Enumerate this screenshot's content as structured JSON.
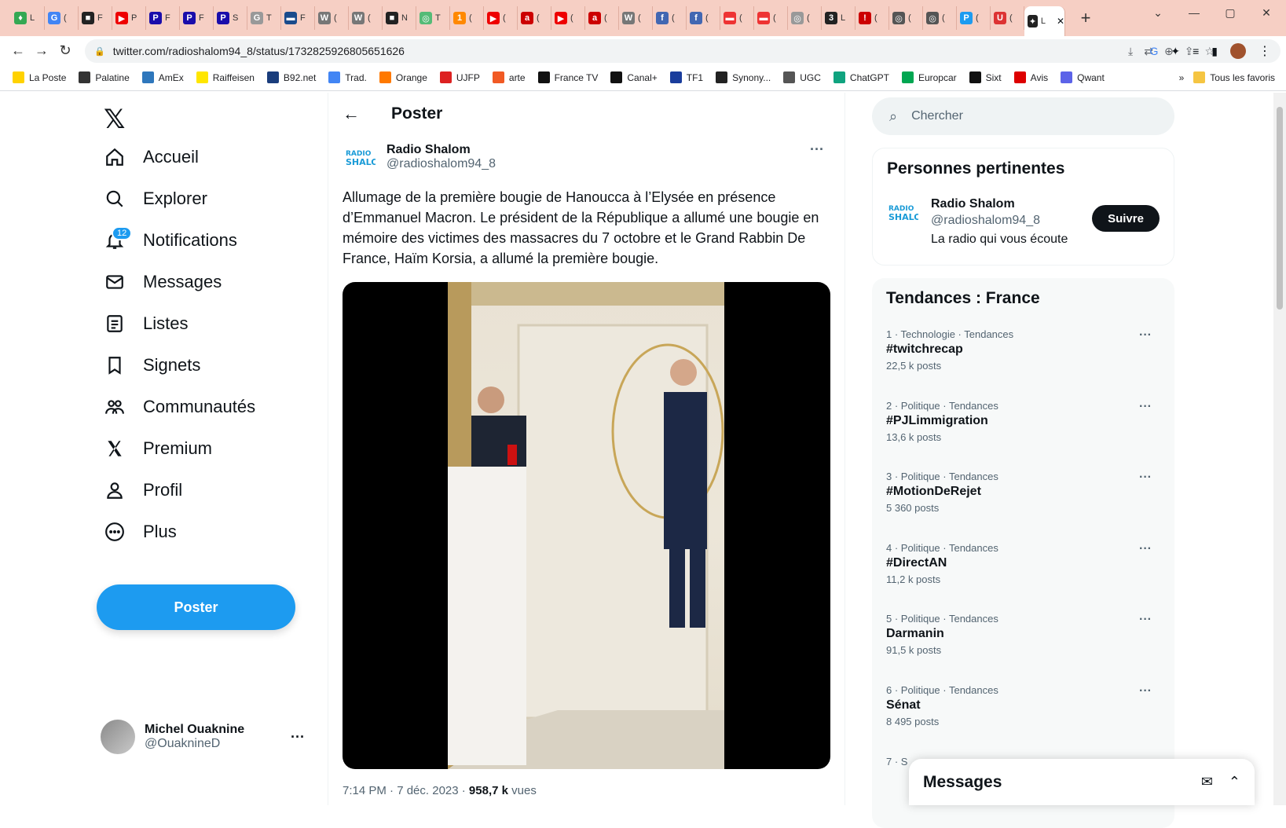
{
  "browser": {
    "tabs": [
      {
        "color": "#34a853",
        "glyph": "♦"
      },
      {
        "color": "#4285f4",
        "glyph": "G"
      },
      {
        "color": "#222",
        "glyph": "■"
      },
      {
        "color": "#e00",
        "glyph": "▶"
      },
      {
        "color": "#1a0dab",
        "glyph": "P"
      },
      {
        "color": "#1a0dab",
        "glyph": "P"
      },
      {
        "color": "#1a0dab",
        "glyph": "P"
      },
      {
        "color": "#999",
        "glyph": "G"
      },
      {
        "color": "#1a4b8c",
        "glyph": "▬"
      },
      {
        "color": "#777",
        "glyph": "W"
      },
      {
        "color": "#777",
        "glyph": "W"
      },
      {
        "color": "#222",
        "glyph": "■"
      },
      {
        "color": "#5b7",
        "glyph": "◎"
      },
      {
        "color": "#f80",
        "glyph": "1"
      },
      {
        "color": "#e00",
        "glyph": "▶"
      },
      {
        "color": "#c00",
        "glyph": "a"
      },
      {
        "color": "#e00",
        "glyph": "▶"
      },
      {
        "color": "#c00",
        "glyph": "a"
      },
      {
        "color": "#777",
        "glyph": "W"
      },
      {
        "color": "#4267b2",
        "glyph": "f"
      },
      {
        "color": "#4267b2",
        "glyph": "f"
      },
      {
        "color": "#e33",
        "glyph": "▬"
      },
      {
        "color": "#e33",
        "glyph": "▬"
      },
      {
        "color": "#999",
        "glyph": "◎"
      },
      {
        "color": "#222",
        "glyph": "3"
      },
      {
        "color": "#c00",
        "glyph": "!"
      },
      {
        "color": "#555",
        "glyph": "◎"
      },
      {
        "color": "#555",
        "glyph": "◎"
      },
      {
        "color": "#1d9bf0",
        "glyph": "P"
      },
      {
        "color": "#d33",
        "glyph": "U"
      },
      {
        "color": "#222",
        "glyph": "✦"
      }
    ],
    "tab_texts": [
      "L",
      "(",
      "F",
      "P",
      "F",
      "F",
      "S",
      "T",
      "F",
      "(",
      "(",
      "N",
      "T",
      "(",
      "(",
      "(",
      "(",
      "(",
      "(",
      "(",
      "(",
      "(",
      "(",
      "(",
      "L",
      "(",
      "(",
      "(",
      "(",
      "(",
      "L"
    ],
    "url": "twitter.com/radioshalom94_8/status/1732825926805651626",
    "bookmarks": [
      {
        "label": "La Poste",
        "color": "#ffd200"
      },
      {
        "label": "Palatine",
        "color": "#333"
      },
      {
        "label": "AmEx",
        "color": "#2e77bc"
      },
      {
        "label": "Raiffeisen",
        "color": "#ffe600"
      },
      {
        "label": "B92.net",
        "color": "#1a3d7c"
      },
      {
        "label": "Trad.",
        "color": "#4285f4"
      },
      {
        "label": "Orange",
        "color": "#ff7900"
      },
      {
        "label": "UJFP",
        "color": "#d22"
      },
      {
        "label": "arte",
        "color": "#f15a24"
      },
      {
        "label": "France TV",
        "color": "#111"
      },
      {
        "label": "Canal+",
        "color": "#111"
      },
      {
        "label": "TF1",
        "color": "#1a3d9c"
      },
      {
        "label": "Synony...",
        "color": "#222"
      },
      {
        "label": "UGC",
        "color": "#555"
      },
      {
        "label": "ChatGPT",
        "color": "#10a37f"
      },
      {
        "label": "Europcar",
        "color": "#00a651"
      },
      {
        "label": "Sixt",
        "color": "#111"
      },
      {
        "label": "Avis",
        "color": "#d00"
      },
      {
        "label": "Qwant",
        "color": "#5c63e8"
      }
    ],
    "all_bookmarks": "Tous les favoris"
  },
  "nav": {
    "items": [
      {
        "label": "Accueil",
        "icon": "home-icon"
      },
      {
        "label": "Explorer",
        "icon": "search-icon"
      },
      {
        "label": "Notifications",
        "icon": "bell-icon"
      },
      {
        "label": "Messages",
        "icon": "mail-icon"
      },
      {
        "label": "Listes",
        "icon": "list-icon"
      },
      {
        "label": "Signets",
        "icon": "bookmark-icon"
      },
      {
        "label": "Communautés",
        "icon": "people-icon"
      },
      {
        "label": "Premium",
        "icon": "x-icon"
      },
      {
        "label": "Profil",
        "icon": "person-icon"
      },
      {
        "label": "Plus",
        "icon": "more-circle-icon"
      }
    ],
    "notif_badge": "12",
    "post_label": "Poster"
  },
  "account": {
    "name": "Michel Ouaknine",
    "handle": "@OuaknineD"
  },
  "header": {
    "title": "Poster"
  },
  "tweet": {
    "author_name": "Radio Shalom",
    "author_handle": "@radioshalom94_8",
    "text": "Allumage de la première bougie de Hanoucca à l’Elysée en présence d’Emmanuel Macron. Le président de la République a allumé une bougie en mémoire des victimes des massacres du 7 octobre et le Grand Rabbin De France, Haïm Korsia, a allumé la première bougie.",
    "time": "7:14 PM · 7 déc. 2023 · ",
    "views": "958,7 k",
    "views_label": " vues"
  },
  "search": {
    "placeholder": "Chercher"
  },
  "relevant": {
    "title": "Personnes pertinentes",
    "name": "Radio Shalom",
    "handle": "@radioshalom94_8",
    "bio": "La radio qui vous écoute",
    "follow": "Suivre"
  },
  "trends": {
    "title": "Tendances : France",
    "items": [
      {
        "meta": "1 · Technologie · Tendances",
        "name": "#twitchrecap",
        "count": "22,5 k posts"
      },
      {
        "meta": "2 · Politique · Tendances",
        "name": "#PJLimmigration",
        "count": "13,6 k posts"
      },
      {
        "meta": "3 · Politique · Tendances",
        "name": "#MotionDeRejet",
        "count": "5 360 posts"
      },
      {
        "meta": "4 · Politique · Tendances",
        "name": "#DirectAN",
        "count": "11,2 k posts"
      },
      {
        "meta": "5 · Politique · Tendances",
        "name": "Darmanin",
        "count": "91,5 k posts"
      },
      {
        "meta": "6 · Politique · Tendances",
        "name": "Sénat",
        "count": "8 495 posts"
      },
      {
        "meta": "7 · S",
        "name": "",
        "count": ""
      }
    ]
  },
  "messages_drawer": {
    "title": "Messages"
  }
}
